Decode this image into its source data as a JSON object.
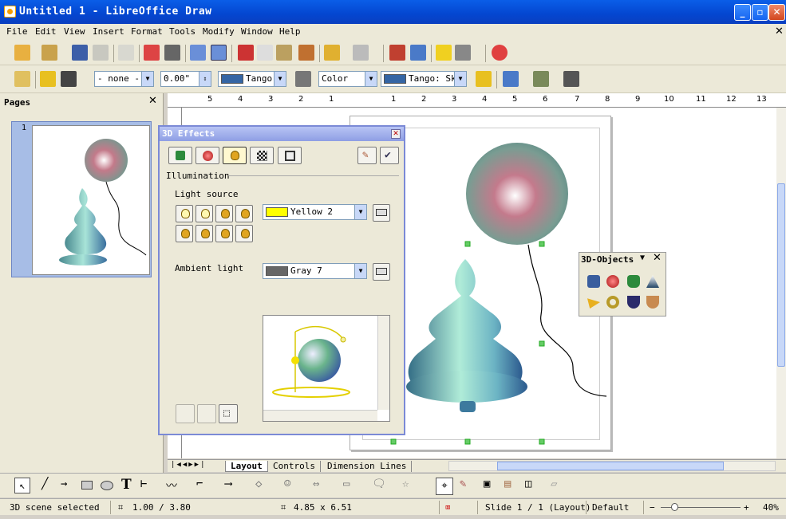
{
  "window": {
    "title": "Untitled 1 - LibreOffice Draw"
  },
  "menu": [
    "File",
    "Edit",
    "View",
    "Insert",
    "Format",
    "Tools",
    "Modify",
    "Window",
    "Help"
  ],
  "linebar": {
    "line_style": "- none -",
    "line_width": "0.00\"",
    "line_color": "Tango",
    "area_style": "Color",
    "area_color": "Tango: Sky"
  },
  "pages_panel": {
    "title": "Pages",
    "page_number": "1"
  },
  "ruler": {
    "labels": [
      "5",
      "4",
      "3",
      "2",
      "1",
      "1",
      "2",
      "3",
      "4",
      "5",
      "6",
      "7",
      "8",
      "9",
      "10",
      "11",
      "12",
      "13"
    ]
  },
  "effects": {
    "title": "3D Effects",
    "section": "Illumination",
    "light_source_label": "Light source",
    "light_color": "Yellow 2",
    "ambient_label": "Ambient light",
    "ambient_color": "Gray 7"
  },
  "objects3d": {
    "title": "3D-Objects"
  },
  "tabs": [
    "Layout",
    "Controls",
    "Dimension Lines"
  ],
  "status": {
    "selection": "3D scene selected",
    "position": "1.00 / 3.80",
    "size": "4.85 x 6.51",
    "slide": "Slide 1 / 1 (Layout)",
    "master": "Default",
    "zoom": "40%"
  },
  "colors": {
    "accent": "#0a5ee8",
    "yellow2": "#ffff00",
    "gray7": "#666666",
    "tango": "#3465a4"
  }
}
